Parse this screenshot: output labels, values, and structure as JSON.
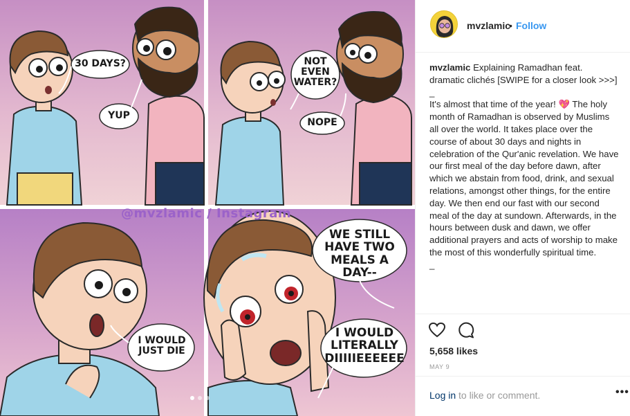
{
  "post": {
    "username": "mvzlamic",
    "separator": "•",
    "follow_label": "Follow"
  },
  "comic": {
    "watermark": "@mvzlamic / Instagram",
    "panel1": {
      "bubble_a": "30 DAYS?",
      "bubble_b": "YUP"
    },
    "panel2": {
      "bubble_a": "NOT\nEVEN\nWATER?",
      "bubble_b": "NOPE"
    },
    "panel3": {
      "bubble_a": "I WOULD\nJUST DIE"
    },
    "panel4": {
      "bubble_a": "WE STILL\nHAVE TWO\nMEALS A DAY--",
      "bubble_b": "I WOULD\nLITERALLY\nDIIIIIEEEEEE"
    },
    "carousel_dots": 3
  },
  "caption": {
    "username": "mvzlamic",
    "intro": "Explaining Ramadhan feat. dramatic clichés [SWIPE for a closer look >>>]",
    "dash_top": "_",
    "body": "It's almost that time of the year! 💖 The holy month of Ramadhan is observed by Muslims all over the world. It takes place over the course of about 30 days and nights in celebration of the Qur'anic revelation. We have our first meal of the day before dawn, after which we abstain from food, drink, and sexual relations, amongst other things, for the entire day. We then end our fast with our second meal of the day at sundown. Afterwards, in the hours between dusk and dawn, we offer additional prayers and acts of worship to make the most of this wonderfully spiritual time.",
    "dash_bottom": "_"
  },
  "actions": {
    "like_icon": "heart-icon",
    "comment_icon": "comment-icon",
    "likes": "5,658 likes",
    "date": "MAY 9"
  },
  "footer": {
    "login_link": "Log in",
    "login_rest": "to like or comment.",
    "more": "•••"
  },
  "colors": {
    "accent": "#3897f0",
    "panel_bg": "#d8a0c8",
    "shirt_blue": "#9fd4e8",
    "shirt_pink": "#f2b4bf",
    "watermark": "#9b62c9"
  }
}
